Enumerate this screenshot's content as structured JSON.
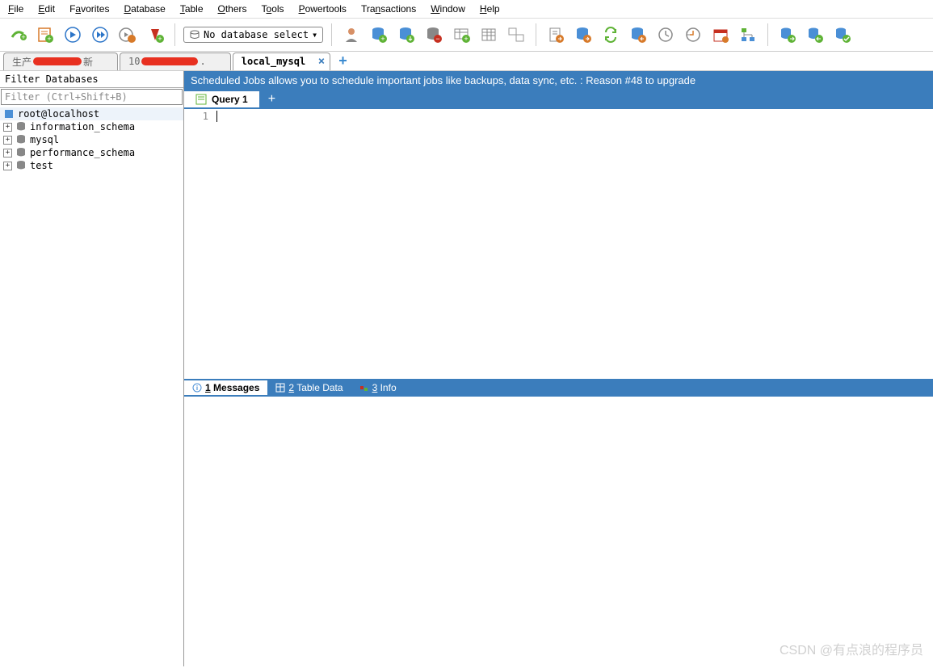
{
  "menu": {
    "file": "File",
    "edit": "Edit",
    "favorites": "Favorites",
    "database": "Database",
    "table": "Table",
    "others": "Others",
    "tools": "Tools",
    "powertools": "Powertools",
    "transactions": "Transactions",
    "window": "Window",
    "help": "Help"
  },
  "toolbar": {
    "db_selector": "No database select"
  },
  "tabs": [
    {
      "label": "生产",
      "redacted": true,
      "suffix": "新"
    },
    {
      "label": "10",
      "redacted": true,
      "suffix": "."
    },
    {
      "label": "local_mysql",
      "active": true
    }
  ],
  "sidebar": {
    "header": "Filter Databases",
    "filter_placeholder": "Filter (Ctrl+Shift+B)",
    "root": "root@localhost",
    "dbs": [
      "information_schema",
      "mysql",
      "performance_schema",
      "test"
    ]
  },
  "banner": "Scheduled Jobs allows you to schedule important jobs like backups, data sync, etc. : Reason #48 to upgrade",
  "query_tab": "Query 1",
  "editor": {
    "line1": "1"
  },
  "result_tabs": {
    "messages": "1 Messages",
    "tabledata": "2 Table Data",
    "info": "3 Info"
  },
  "watermark": "CSDN @有点浪的程序员"
}
